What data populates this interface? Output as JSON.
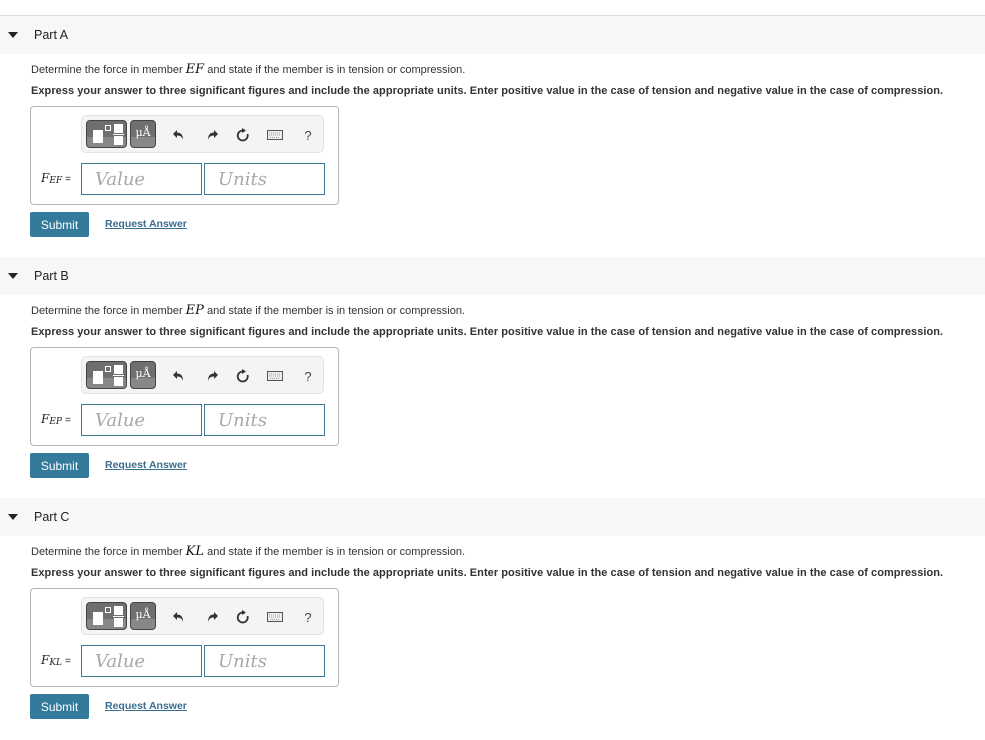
{
  "parts": [
    {
      "title": "Part A",
      "question_prefix": "Determine the force in member ",
      "member": "EF",
      "question_suffix": " and state if the member is in tension or compression.",
      "instructions": "Express your answer to three significant figures and include the appropriate units. Enter positive value in the case of tension and negative value in the case of compression.",
      "label_var": "F",
      "label_sub": "EF",
      "label_eq": "=",
      "value_placeholder": "Value",
      "units_placeholder": "Units",
      "submit_label": "Submit",
      "request_label": "Request Answer"
    },
    {
      "title": "Part B",
      "question_prefix": "Determine the force in member ",
      "member": "EP",
      "question_suffix": " and state if the member is in tension or compression.",
      "instructions": "Express your answer to three significant figures and include the appropriate units. Enter positive value in the case of tension and negative value in the case of compression.",
      "label_var": "F",
      "label_sub": "EP",
      "label_eq": "=",
      "value_placeholder": "Value",
      "units_placeholder": "Units",
      "submit_label": "Submit",
      "request_label": "Request Answer"
    },
    {
      "title": "Part C",
      "question_prefix": "Determine the force in member ",
      "member": "KL",
      "question_suffix": " and state if the member is in tension or compression.",
      "instructions": "Express your answer to three significant figures and include the appropriate units. Enter positive value in the case of tension and negative value in the case of compression.",
      "label_var": "F",
      "label_sub": "KL",
      "label_eq": "=",
      "value_placeholder": "Value",
      "units_placeholder": "Units",
      "submit_label": "Submit",
      "request_label": "Request Answer"
    }
  ],
  "toolbar": {
    "templates_icon": "templates-icon",
    "units_label": "μÅ",
    "undo_icon": "undo-icon",
    "redo_icon": "redo-icon",
    "reset_icon": "reset-icon",
    "keyboard_icon": "keyboard-icon",
    "help_label": "?"
  },
  "colors": {
    "accent": "#337a9b",
    "link": "#3a6e90",
    "input_border": "#3a7896",
    "header_bg": "#f7f7f7"
  }
}
